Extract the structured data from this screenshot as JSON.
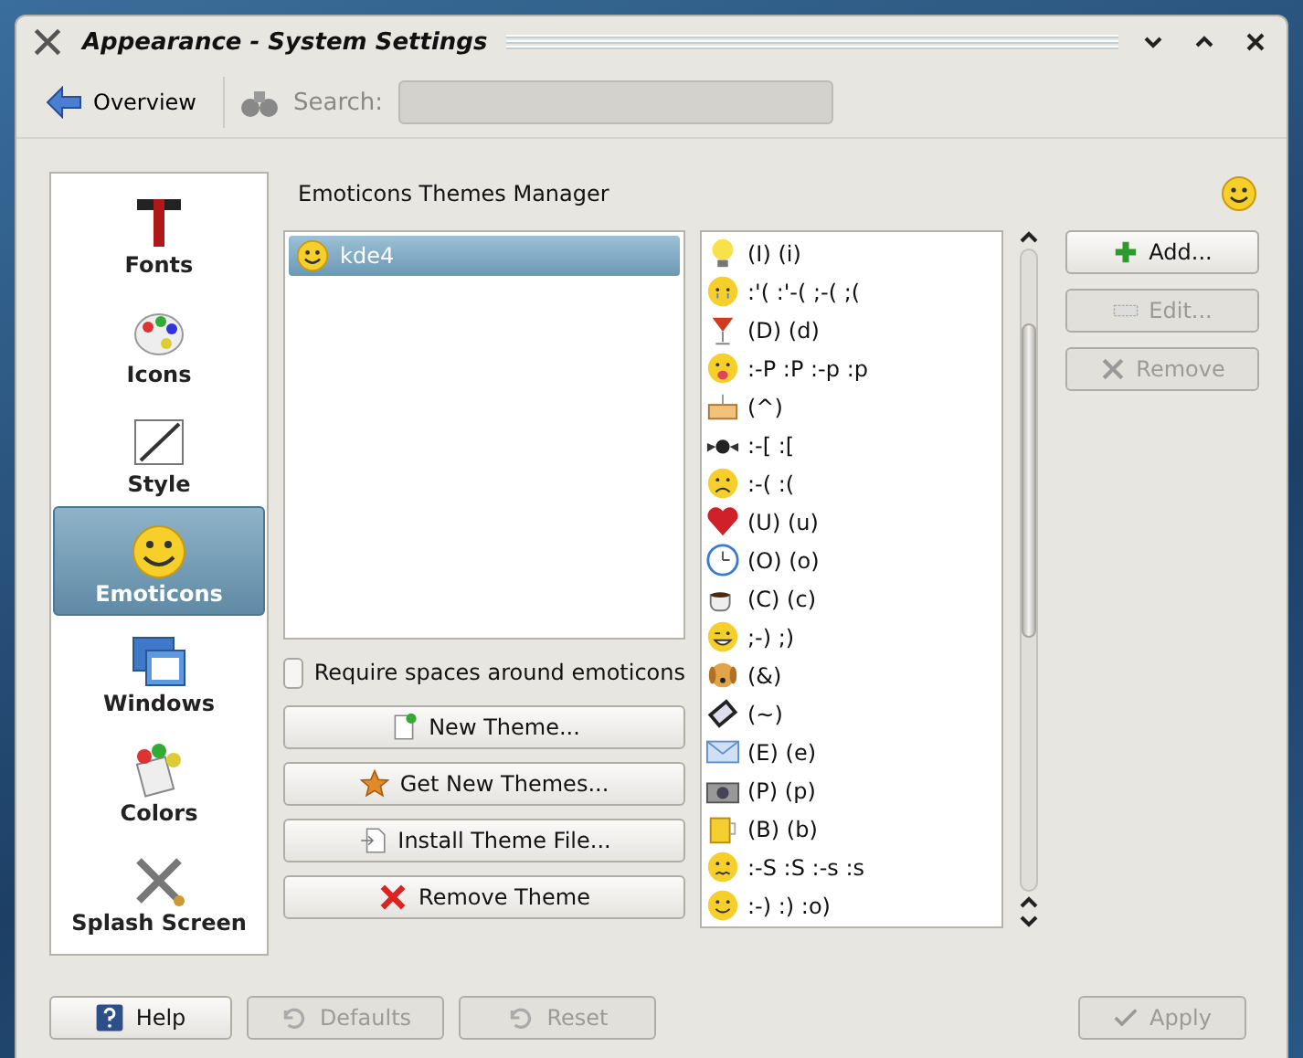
{
  "window": {
    "title": "Appearance - System Settings"
  },
  "toolbar": {
    "overview": "Overview",
    "search_label": "Search:"
  },
  "sidebar": {
    "items": [
      {
        "label": "Fonts",
        "selected": false
      },
      {
        "label": "Icons",
        "selected": false
      },
      {
        "label": "Style",
        "selected": false
      },
      {
        "label": "Emoticons",
        "selected": true
      },
      {
        "label": "Windows",
        "selected": false
      },
      {
        "label": "Colors",
        "selected": false
      },
      {
        "label": "Splash Screen",
        "selected": false
      }
    ]
  },
  "heading": "Emoticons Themes Manager",
  "themes": [
    {
      "label": "kde4",
      "selected": true
    }
  ],
  "require_spaces": {
    "label": "Require spaces around emoticons",
    "checked": false
  },
  "theme_buttons": [
    {
      "label": "New Theme..."
    },
    {
      "label": "Get New Themes..."
    },
    {
      "label": "Install Theme File..."
    },
    {
      "label": "Remove Theme"
    }
  ],
  "emoticons": [
    {
      "text": "(I) (i)"
    },
    {
      "text": ":'( :'-( ;-( ;("
    },
    {
      "text": "(D) (d)"
    },
    {
      "text": ":-P :P :-p :p"
    },
    {
      "text": "(^)"
    },
    {
      "text": ":-[ :["
    },
    {
      "text": ":-( :("
    },
    {
      "text": "(U) (u)"
    },
    {
      "text": "(O) (o)"
    },
    {
      "text": "(C) (c)"
    },
    {
      "text": ";-) ;)"
    },
    {
      "text": "(&)"
    },
    {
      "text": "(~)"
    },
    {
      "text": "(E) (e)"
    },
    {
      "text": "(P) (p)"
    },
    {
      "text": "(B) (b)"
    },
    {
      "text": ":-S :S :-s :s"
    },
    {
      "text": ":-) :) :o)"
    }
  ],
  "emoticon_buttons": [
    {
      "label": "Add...",
      "disabled": false
    },
    {
      "label": "Edit...",
      "disabled": true
    },
    {
      "label": "Remove",
      "disabled": true
    }
  ],
  "footer": {
    "left": [
      {
        "label": "Help",
        "disabled": false
      },
      {
        "label": "Defaults",
        "disabled": true
      },
      {
        "label": "Reset",
        "disabled": true
      }
    ],
    "right": [
      {
        "label": "Apply",
        "disabled": true
      }
    ]
  }
}
